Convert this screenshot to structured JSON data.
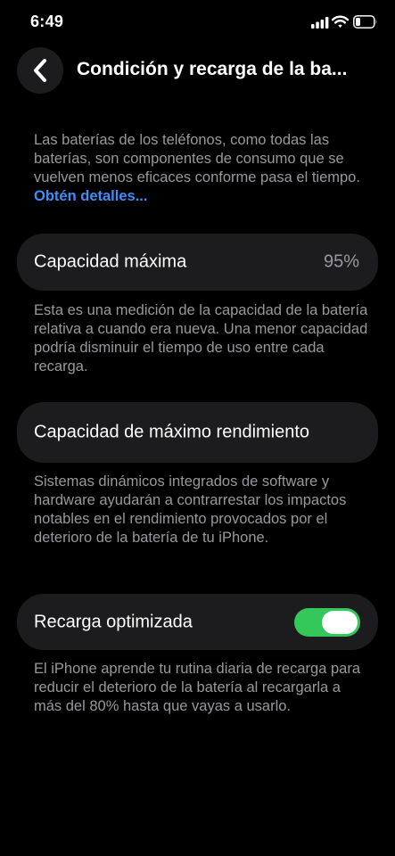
{
  "status_bar": {
    "time": "6:49"
  },
  "nav": {
    "title": "Condición y recarga de la ba..."
  },
  "intro": {
    "text": "Las baterías de los teléfonos, como todas las baterías, son componentes de consumo que se vuelven menos eficaces conforme pasa el tiempo. ",
    "link": "Obtén detalles..."
  },
  "max_capacity": {
    "label": "Capacidad máxima",
    "value": "95%",
    "description": "Esta es una medición de la capacidad de la batería relativa a cuando era nueva. Una menor capacidad podría disminuir el tiempo de uso entre cada recarga."
  },
  "peak_performance": {
    "label": "Capacidad de máximo rendimiento",
    "description": "Sistemas dinámicos integrados de software y hardware ayudarán a contrarrestar los impactos notables en el rendimiento provocados por el deterioro de la batería de tu iPhone."
  },
  "optimized_charging": {
    "label": "Recarga optimizada",
    "enabled": true,
    "description": "El iPhone aprende tu rutina diaria de recarga para reducir el deterioro de la batería al recargarla a más del 80% hasta que vayas a usarlo."
  },
  "colors": {
    "background": "#000000",
    "card": "#1c1c1e",
    "secondary_text": "#98989e",
    "link": "#3f8ef8",
    "toggle_on": "#34c759"
  },
  "icons": {
    "back": "chevron-left-icon",
    "signal": "cellular-signal-icon",
    "wifi": "wifi-icon",
    "battery": "battery-icon"
  }
}
